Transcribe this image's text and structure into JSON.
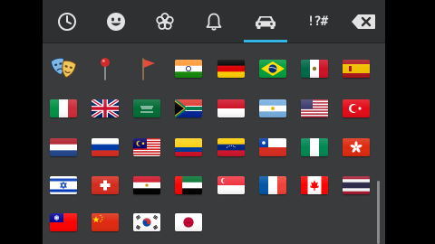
{
  "tabs": [
    {
      "id": "recent",
      "icon": "clock-icon",
      "active": false
    },
    {
      "id": "smileys",
      "icon": "smiley-icon",
      "active": false
    },
    {
      "id": "nature",
      "icon": "flower-icon",
      "active": false
    },
    {
      "id": "objects",
      "icon": "bell-icon",
      "active": false
    },
    {
      "id": "places",
      "icon": "car-icon",
      "active": true
    },
    {
      "id": "symbols",
      "icon": "symbols-icon",
      "label": "!?#",
      "active": false
    }
  ],
  "delete_key": {
    "icon": "backspace-icon"
  },
  "accent_color": "#33b5e5",
  "emoji_rows": [
    [
      "performing-arts",
      "round-pushpin",
      "triangular-flag",
      "flag-india",
      "flag-germany",
      "flag-brazil",
      "flag-mexico",
      "flag-spain"
    ],
    [
      "flag-italy",
      "flag-united-kingdom",
      "flag-saudi-arabia",
      "flag-south-africa",
      "flag-indonesia",
      "flag-argentina",
      "flag-united-states",
      "flag-turkey"
    ],
    [
      "flag-netherlands",
      "flag-russia",
      "flag-malaysia",
      "flag-colombia",
      "flag-venezuela",
      "flag-chile",
      "flag-nigeria",
      "flag-hong-kong"
    ],
    [
      "flag-israel",
      "flag-switzerland",
      "flag-egypt",
      "flag-united-arab-emirates",
      "flag-singapore",
      "flag-france",
      "flag-canada",
      "flag-thailand"
    ],
    [
      "flag-taiwan",
      "flag-china",
      "flag-south-korea",
      "flag-japan"
    ]
  ]
}
